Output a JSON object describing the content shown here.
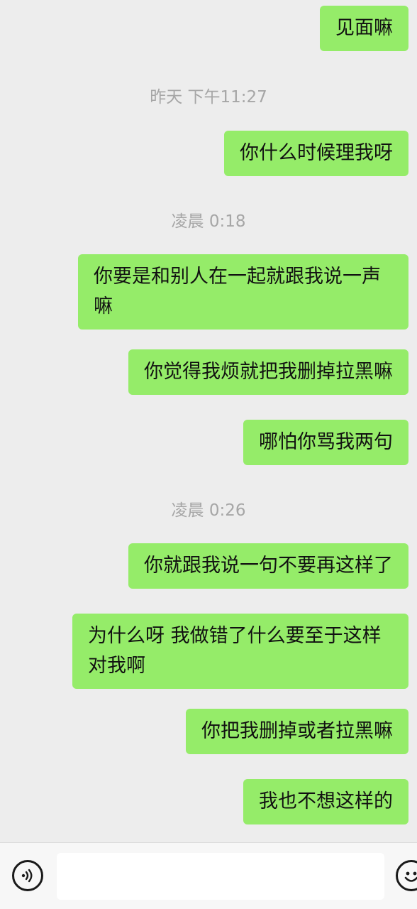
{
  "messages": [
    {
      "text": "见面嘛"
    },
    {
      "text": "你什么时候理我呀"
    },
    {
      "text": "你要是和别人在一起就跟我说一声嘛"
    },
    {
      "text": "你觉得我烦就把我删掉拉黑嘛"
    },
    {
      "text": "哪怕你骂我两句"
    },
    {
      "text": "你就跟我说一句不要再这样了"
    },
    {
      "text": "为什么呀 我做错了什么要至于这样对我啊"
    },
    {
      "text": "你把我删掉或者拉黑嘛"
    },
    {
      "text": "我也不想这样的"
    }
  ],
  "timestamps": [
    "昨天 下午11:27",
    "凌晨 0:18",
    "凌晨 0:26"
  ],
  "input": {
    "value": "",
    "voice_icon": "voice-icon",
    "emoji_icon": "emoji-icon"
  },
  "colors": {
    "bubble": "#95ec69",
    "background": "#ededed",
    "timestamp": "#a6a6a6"
  }
}
